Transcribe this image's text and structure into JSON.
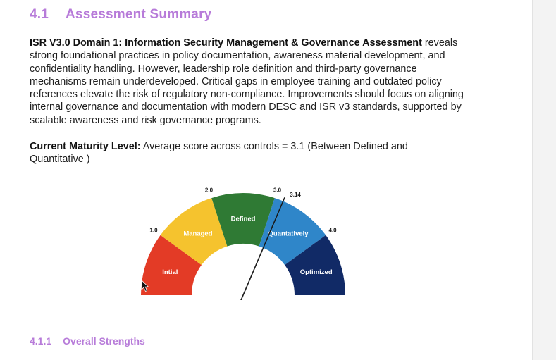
{
  "section": {
    "number": "4.1",
    "title": "Assessment Summary"
  },
  "summary": {
    "lead": "ISR V3.0 Domain 1:  Information Security Management & Governance Assessment",
    "body": " reveals strong foundational practices in policy documentation, awareness material development, and confidentiality handling. However, leadership role definition and third-party governance mechanisms remain underdeveloped. Critical gaps in employee training and outdated policy references elevate the risk of regulatory non-compliance. Improvements should focus on aligning internal governance and documentation with modern DESC and ISR v3 standards, supported by scalable awareness and risk governance programs."
  },
  "maturity": {
    "label": "Current Maturity Level:",
    "text": " Average score across controls = 3.1 (Between Defined and Quantitative )"
  },
  "chart_data": {
    "type": "gauge",
    "scale": [
      0.0,
      5.0
    ],
    "bands": [
      {
        "name": "Intial",
        "from": 0.0,
        "to": 1.0,
        "color": "#e33b26"
      },
      {
        "name": "Managed",
        "from": 1.0,
        "to": 2.0,
        "color": "#f5c32e"
      },
      {
        "name": "Defined",
        "from": 2.0,
        "to": 3.0,
        "color": "#2f7a34"
      },
      {
        "name": "Quantatively",
        "from": 3.0,
        "to": 4.0,
        "color": "#2f86c9"
      },
      {
        "name": "Optimized",
        "from": 4.0,
        "to": 5.0,
        "color": "#112a66"
      }
    ],
    "tick_labels": [
      "1.0",
      "2.0",
      "3.0",
      "4.0"
    ],
    "needle": {
      "value": 3.14,
      "label": "3.14",
      "color": "#1a1a1a"
    }
  },
  "subsection": {
    "number": "4.1.1",
    "title": "Overall Strengths"
  }
}
